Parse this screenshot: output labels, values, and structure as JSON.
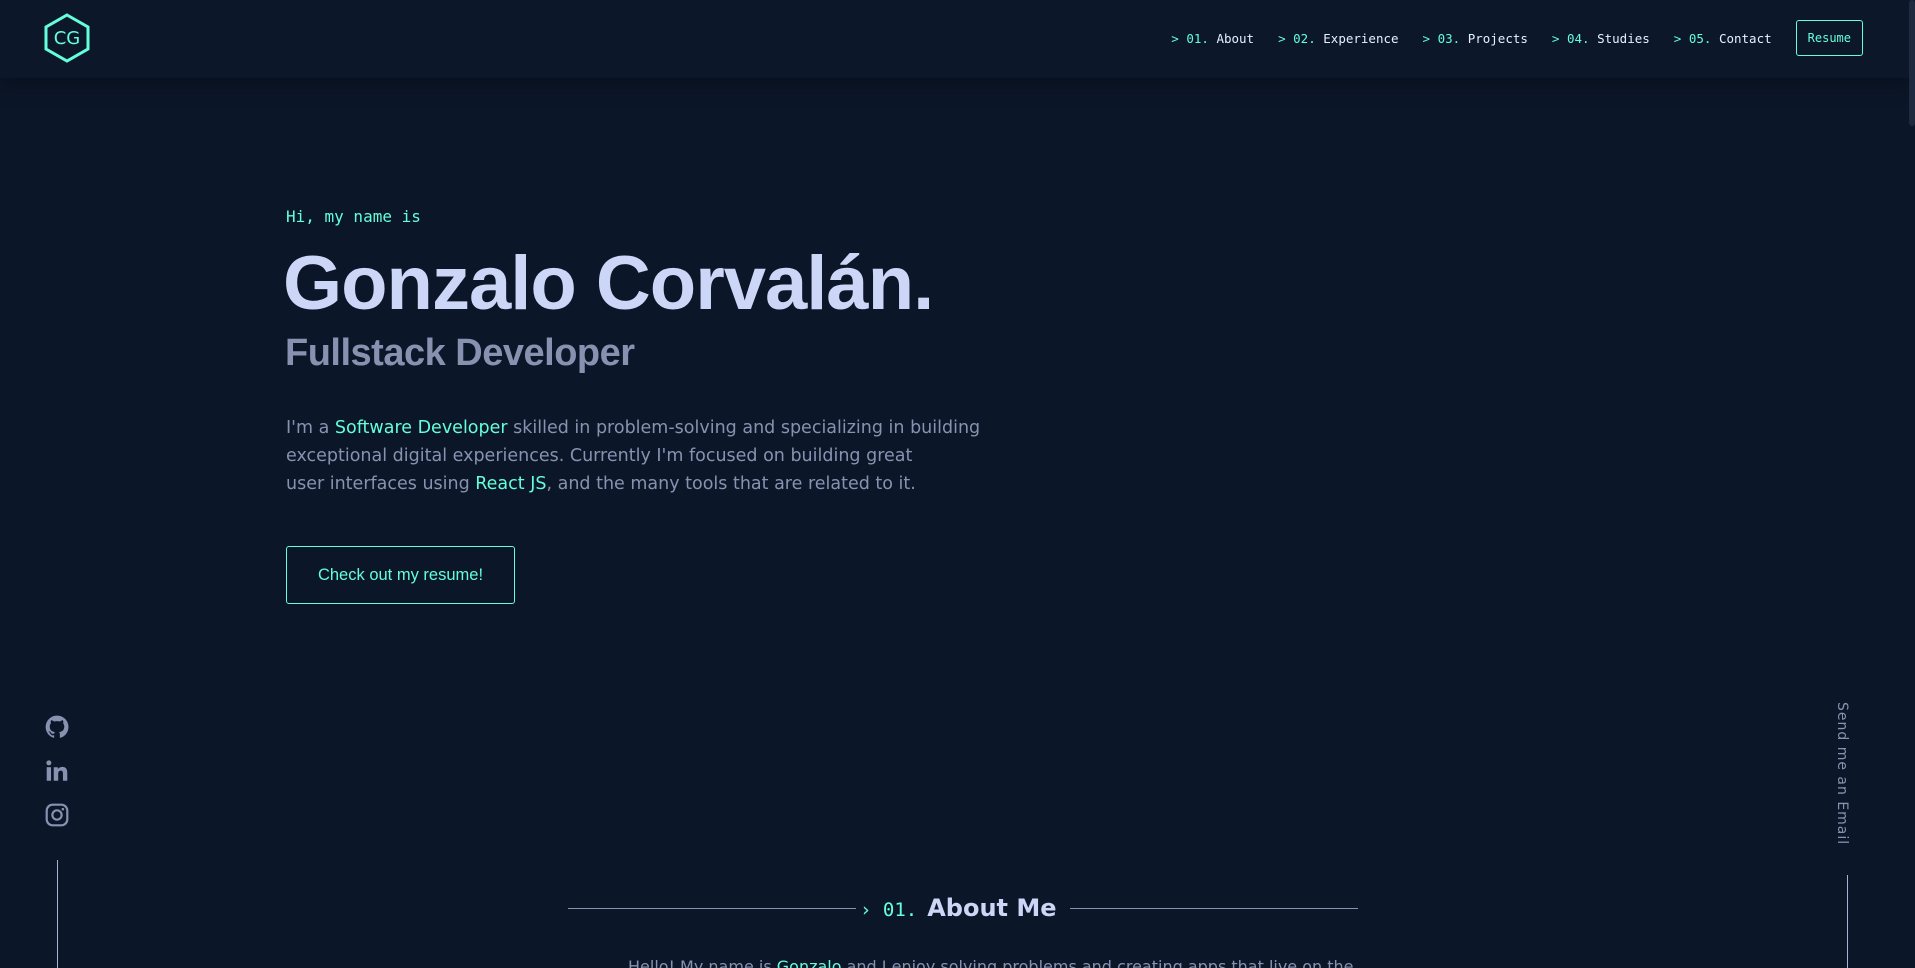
{
  "header": {
    "logo_text": "CG",
    "nav": [
      {
        "prefix": "> ",
        "num": "01.",
        "label": "About"
      },
      {
        "prefix": "> ",
        "num": "02.",
        "label": "Experience"
      },
      {
        "prefix": "> ",
        "num": "03.",
        "label": "Projects"
      },
      {
        "prefix": "> ",
        "num": "04.",
        "label": "Studies"
      },
      {
        "prefix": "> ",
        "num": "05.",
        "label": "Contact"
      }
    ],
    "resume_label": "Resume"
  },
  "hero": {
    "greeting": "Hi, my name is",
    "name": "Gonzalo Corvalán.",
    "role": "Fullstack Developer",
    "desc": {
      "p1": "I'm a ",
      "h1": "Software Developer",
      "p2": " skilled in problem-solving and specializing in building",
      "p3": "exceptional digital experiences. Currently I'm focused on building great",
      "p4": "user interfaces using ",
      "h2": "React JS",
      "p5": ", and the many tools that are related to it."
    },
    "cta_label": "Check out my resume!"
  },
  "social": {
    "icons": [
      "github-icon",
      "linkedin-icon",
      "instagram-icon"
    ]
  },
  "email": {
    "label": "Send me an Email"
  },
  "about": {
    "num": "› 01.",
    "title": "About Me",
    "text_p1": "Hello! My name is ",
    "text_h": "Gonzalo",
    "text_p2": " and I enjoy solving problems and creating apps that live on the"
  },
  "colors": {
    "background": "#0b1628",
    "accent": "#64ffda",
    "heading": "#ccd6f6",
    "muted": "#8892b0"
  }
}
